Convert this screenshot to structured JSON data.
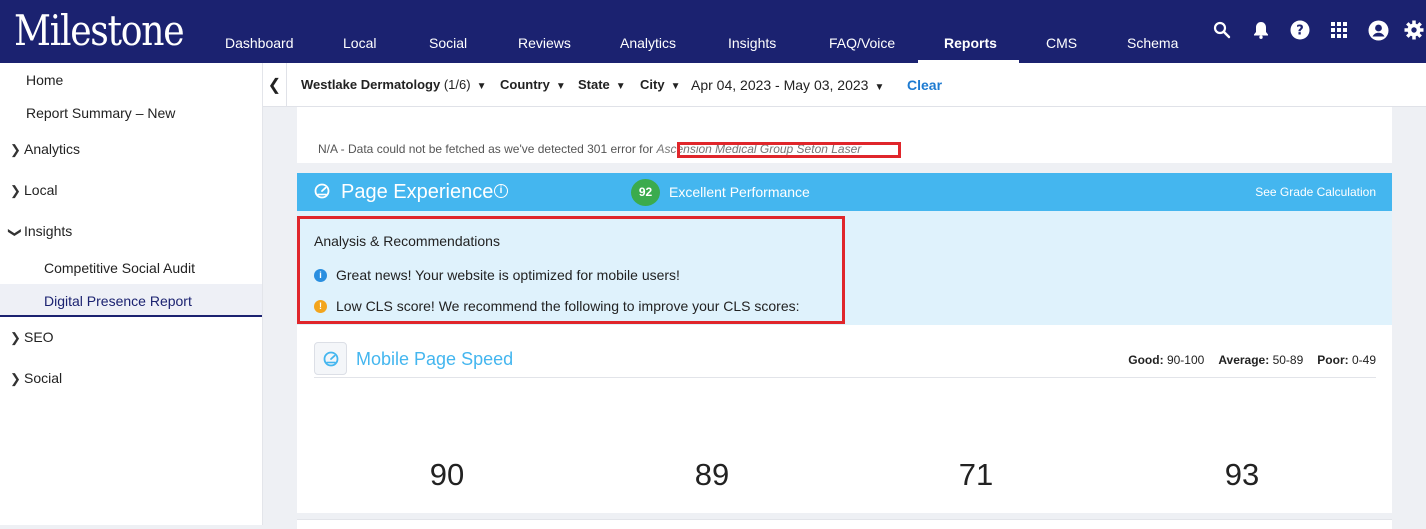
{
  "app": {
    "logo": "Milestone"
  },
  "nav": {
    "items": [
      "Dashboard",
      "Local",
      "Social",
      "Reviews",
      "Analytics",
      "Insights",
      "FAQ/Voice",
      "Reports",
      "CMS",
      "Schema"
    ],
    "active": "Reports"
  },
  "top_icons": [
    "search-icon",
    "bell-icon",
    "help-icon",
    "apps-grid-icon",
    "account-icon",
    "gear-icon"
  ],
  "sidebar": {
    "items": [
      {
        "label": "Home"
      },
      {
        "label": "Report Summary – New"
      },
      {
        "label": "Analytics"
      },
      {
        "label": "Local"
      },
      {
        "label": "Insights"
      },
      {
        "label": "Competitive Social Audit"
      },
      {
        "label": "Digital Presence Report"
      },
      {
        "label": "SEO"
      },
      {
        "label": "Social"
      }
    ]
  },
  "filters": {
    "location_name": "Westlake Dermatology",
    "location_count": "(1/6)",
    "country": "Country",
    "state": "State",
    "city": "City",
    "date_range": "Apr 04, 2023 - May 03, 2023",
    "clear": "Clear"
  },
  "notice": {
    "text": "N/A - Data could not be fetched as we've detected 301 error for ",
    "site": "Ascension Medical Group Seton Laser"
  },
  "page_experience": {
    "title": "Page Experience",
    "score": "92",
    "performance": "Excellent Performance",
    "grade_link": "See Grade Calculation"
  },
  "analysis": {
    "title": "Analysis & Recommendations",
    "items": [
      "Great news! Your website is optimized for mobile users!",
      "Low CLS score! We recommend the following to improve your CLS scores:"
    ]
  },
  "mobile_speed": {
    "title": "Mobile Page Speed",
    "legend": {
      "good_label": "Good:",
      "good_range": "90-100",
      "average_label": "Average:",
      "average_range": "50-89",
      "poor_label": "Poor:",
      "poor_range": "0-49"
    },
    "scores": [
      "90",
      "89",
      "71",
      "93"
    ]
  },
  "colors": {
    "nav_bg": "#1b2270",
    "accent_blue": "#44b6ef",
    "score_green": "#3bab4d",
    "highlight_red": "#e0262b",
    "link_blue": "#1e7bd1"
  }
}
